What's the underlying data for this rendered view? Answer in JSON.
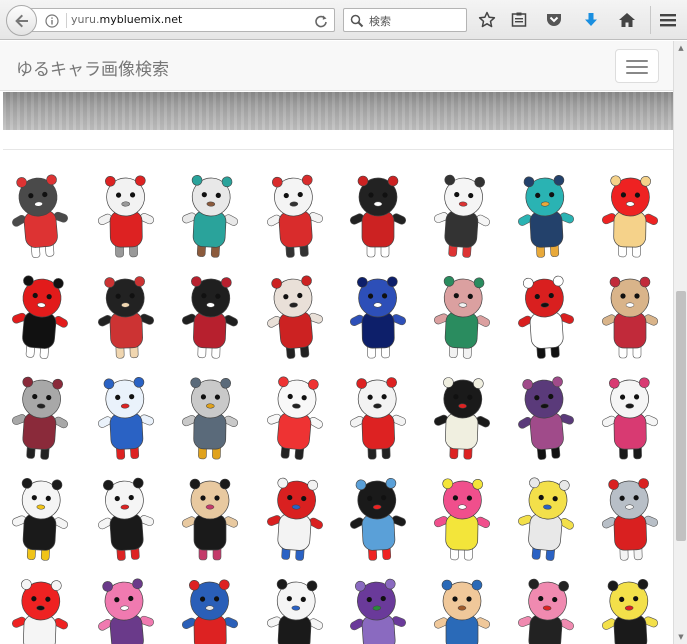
{
  "browser": {
    "url_prefix": "yuru.",
    "url_domain": "mybluemix.net",
    "search_placeholder": "検索"
  },
  "site": {
    "brand": "ゆるキャラ画像検索"
  },
  "characters": [
    {
      "name": "bear-glasses",
      "body": "#4a4a4a",
      "accent": "#d33",
      "extra": "#ffffff"
    },
    {
      "name": "white-bear-red-scarf",
      "body": "#f2f2f2",
      "accent": "#d22",
      "extra": "#999999"
    },
    {
      "name": "hat-character-blue",
      "body": "#e8e8e8",
      "accent": "#2aa39b",
      "extra": "#8b5a3c"
    },
    {
      "name": "santa-gnome",
      "body": "#f4f4f4",
      "accent": "#d92c2c",
      "extra": "#333333"
    },
    {
      "name": "black-battery",
      "body": "#222222",
      "accent": "#c22",
      "extra": "#ffffff"
    },
    {
      "name": "cow-boy",
      "body": "#f5f5f5",
      "accent": "#333",
      "extra": "#d33"
    },
    {
      "name": "teal-ghost-cap",
      "body": "#2ab3b3",
      "accent": "#23416b",
      "extra": "#e8a93a"
    },
    {
      "name": "red-hood-girl",
      "body": "#e22",
      "accent": "#f5d28a",
      "extra": "#ffffff"
    },
    {
      "name": "red-cat-black-shirt",
      "body": "#e21b1b",
      "accent": "#111",
      "extra": "#ffffff"
    },
    {
      "name": "dark-blob-glasses",
      "body": "#222222",
      "accent": "#c33",
      "extra": "#f0d6b0"
    },
    {
      "name": "black-white-dog",
      "body": "#1f1f1f",
      "accent": "#b7202e",
      "extra": "#ffffff"
    },
    {
      "name": "samurai-girl",
      "body": "#e9e0d8",
      "accent": "#c22",
      "extra": "#222"
    },
    {
      "name": "blue-train",
      "body": "#2d4fb8",
      "accent": "#0d1f6a",
      "extra": "#ffffff"
    },
    {
      "name": "pink-gown-character",
      "body": "#dba0a0",
      "accent": "#2a8c5f",
      "extra": "#f2f2f2"
    },
    {
      "name": "red-ninja-cat",
      "body": "#d91f1f",
      "accent": "#fff",
      "extra": "#111"
    },
    {
      "name": "tan-doll-red-dress",
      "body": "#d9b48a",
      "accent": "#c12a3a",
      "extra": "#ffffff"
    },
    {
      "name": "grey-cat-kimono",
      "body": "#a8a8a8",
      "accent": "#8a2a3a",
      "extra": "#222"
    },
    {
      "name": "crown-bear-cape",
      "body": "#eaf2fb",
      "accent": "#2a62c4",
      "extra": "#d22"
    },
    {
      "name": "tall-grey-head",
      "body": "#c9c9c9",
      "accent": "#5a6a7a",
      "extra": "#e0a21c"
    },
    {
      "name": "white-rabbit-fork",
      "body": "#f8f8f8",
      "accent": "#e33",
      "extra": "#222"
    },
    {
      "name": "egg-sailor",
      "body": "#f3f3f3",
      "accent": "#d22",
      "extra": "#222"
    },
    {
      "name": "black-and-white-bears",
      "body": "#1a1a1a",
      "accent": "#f0efe0",
      "extra": "#d22"
    },
    {
      "name": "kimono-doll-sword",
      "body": "#5a3a7a",
      "accent": "#a04b8a",
      "extra": "#111"
    },
    {
      "name": "geisha-panda-flower",
      "body": "#f5f5f5",
      "accent": "#d83a72",
      "extra": "#1a1a1a"
    },
    {
      "name": "panda-yellow-collar",
      "body": "#f5f5f5",
      "accent": "#1a1a1a",
      "extra": "#f0c419"
    },
    {
      "name": "tuxedo-robot",
      "body": "#f5f5f5",
      "accent": "#1a1a1a",
      "extra": "#d22"
    },
    {
      "name": "long-hair-girl-kimono",
      "body": "#e8c9a0",
      "accent": "#1a1a1a",
      "extra": "#c43a6a"
    },
    {
      "name": "red-robot",
      "body": "#d92020",
      "accent": "#f3f3f3",
      "extra": "#2a62c4"
    },
    {
      "name": "black-bird-blue-beak",
      "body": "#1a1a1a",
      "accent": "#5aa0d8",
      "extra": "#e22"
    },
    {
      "name": "pink-fox-yellow",
      "body": "#f04f8c",
      "accent": "#f3e53a",
      "extra": "#ffffff"
    },
    {
      "name": "egg-yellow-body",
      "body": "#f3e04a",
      "accent": "#e8e8e8",
      "extra": "#2a62c4"
    },
    {
      "name": "grey-penguin-red",
      "body": "#b8bfc7",
      "accent": "#d92020",
      "extra": "#f3f3f3"
    },
    {
      "name": "red-rooster",
      "body": "#e22",
      "accent": "#f5f5f5",
      "extra": "#111"
    },
    {
      "name": "pink-dog-purple",
      "body": "#f07ab0",
      "accent": "#6a3a8a",
      "extra": "#ffffff"
    },
    {
      "name": "blue-robot-red",
      "body": "#2a5fb8",
      "accent": "#d22",
      "extra": "#e9e9e9"
    },
    {
      "name": "cow-character",
      "body": "#f5f5f5",
      "accent": "#1a1a1a",
      "extra": "#2a62c4"
    },
    {
      "name": "purple-eggplants",
      "body": "#6a3a9a",
      "accent": "#8a6ac0",
      "extra": "#2a8a3a"
    },
    {
      "name": "boy-with-cap",
      "body": "#f0c89a",
      "accent": "#2a6ab8",
      "extra": "#a05a2a"
    },
    {
      "name": "pink-pig-bike",
      "body": "#f08ab0",
      "accent": "#222",
      "extra": "#d22"
    },
    {
      "name": "yellow-kabuki",
      "body": "#f3e04a",
      "accent": "#1a1a1a",
      "extra": "#d22"
    }
  ]
}
